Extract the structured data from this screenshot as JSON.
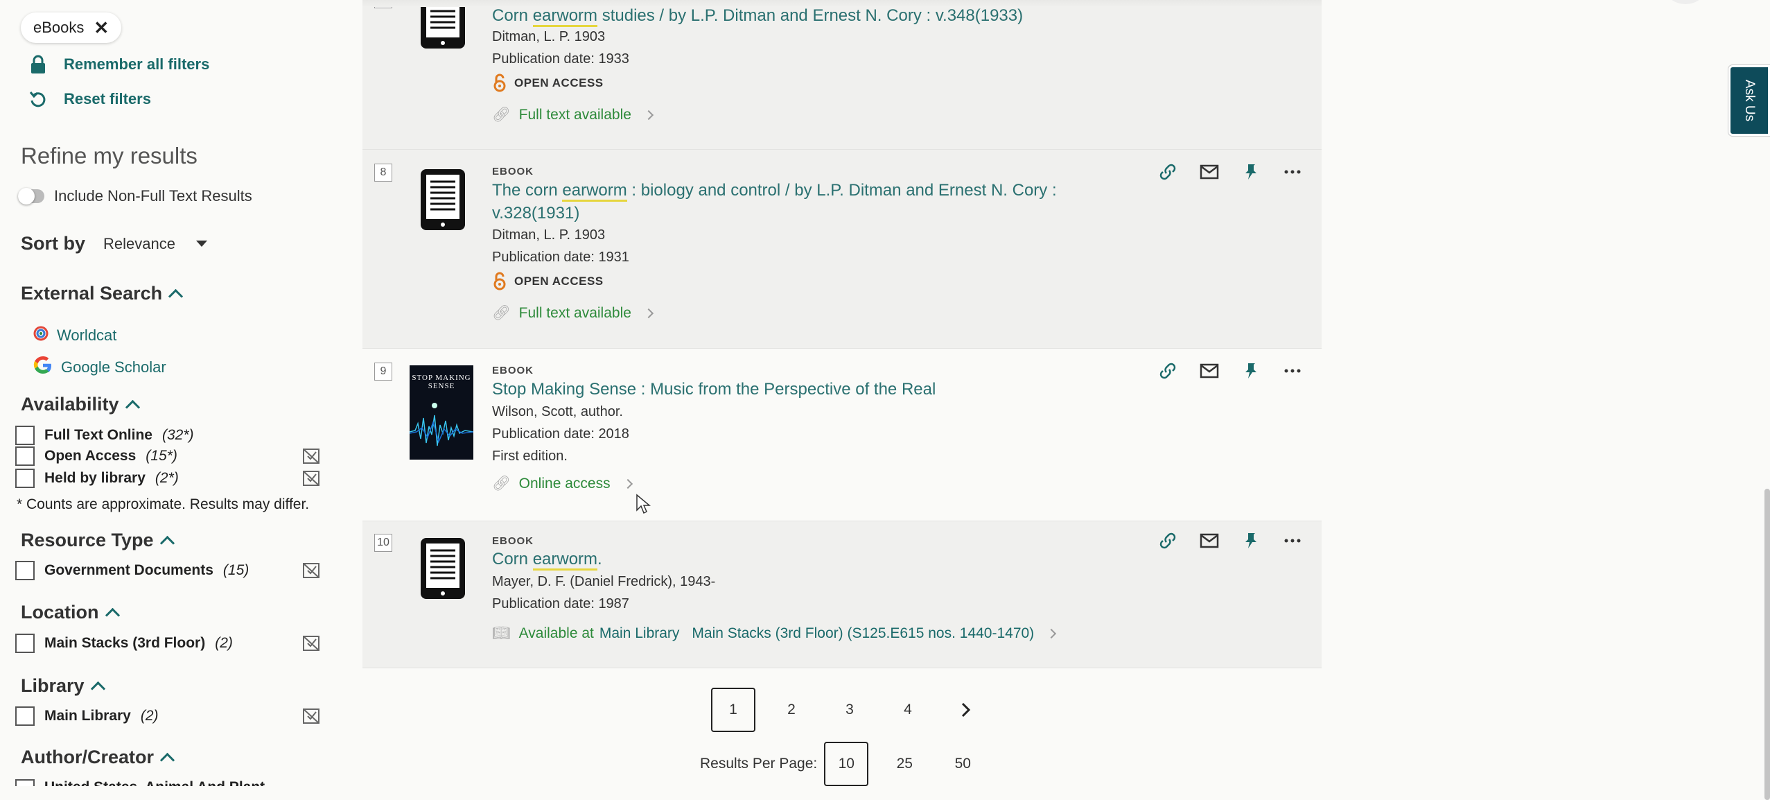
{
  "sidebar": {
    "chip_label": "eBooks",
    "remember_filters": "Remember all filters",
    "reset_filters": "Reset filters",
    "refine_title": "Refine my results",
    "include_non_full_text": "Include Non-Full Text Results",
    "sort_label": "Sort by",
    "sort_value": "Relevance",
    "external_search": {
      "title": "External Search",
      "items": [
        "Worldcat",
        "Google Scholar"
      ]
    },
    "availability": {
      "title": "Availability",
      "items": [
        {
          "name": "Full Text Online",
          "count": "(32*)"
        },
        {
          "name": "Open Access",
          "count": "(15*)"
        },
        {
          "name": "Held by library",
          "count": "(2*)"
        }
      ],
      "note": "* Counts are approximate. Results may differ."
    },
    "resource_type": {
      "title": "Resource Type",
      "items": [
        {
          "name": "Government Documents",
          "count": "(15)"
        }
      ]
    },
    "location": {
      "title": "Location",
      "items": [
        {
          "name": "Main Stacks (3rd Floor)",
          "count": "(2)"
        }
      ]
    },
    "library": {
      "title": "Library",
      "items": [
        {
          "name": "Main Library",
          "count": "(2)"
        }
      ]
    },
    "author": {
      "title": "Author/Creator",
      "partial_item": "United States. Animal And Plant"
    }
  },
  "results": [
    {
      "title_pre": "Corn ",
      "title_hl": "earworm",
      "title_post": " studies / by L.P. Ditman and Ernest N. Cory : v.348(1933)",
      "author": "Ditman, L. P. 1903",
      "pubdate": "Publication date: 1933",
      "open_access": "OPEN ACCESS",
      "link": "Full text available"
    },
    {
      "number": "8",
      "type": "EBOOK",
      "title_pre": "The corn ",
      "title_hl": "earworm",
      "title_post": " : biology and control / by L.P. Ditman and Ernest N. Cory : v.328(1931)",
      "author": "Ditman, L. P. 1903",
      "pubdate": "Publication date: 1931",
      "open_access": "OPEN ACCESS",
      "link": "Full text available"
    },
    {
      "number": "9",
      "type": "EBOOK",
      "title": "Stop Making Sense : Music from the Perspective of the Real",
      "author": "Wilson, Scott, author.",
      "pubdate": "Publication date: 2018",
      "edition": "First edition.",
      "link": "Online access",
      "cover_title": "STOP MAKING SENSE"
    },
    {
      "number": "10",
      "type": "EBOOK",
      "title_pre": "Corn ",
      "title_hl": "earworm",
      "title_post": ".",
      "author": "Mayer, D. F. (Daniel Fredrick), 1943-",
      "pubdate": "Publication date: 1987",
      "avail_prefix": "Available at",
      "avail_library": "Main Library",
      "avail_location": "Main Stacks (3rd Floor) (S125.E615 nos. 1440-1470)"
    }
  ],
  "pagination": {
    "pages": [
      "1",
      "2",
      "3",
      "4"
    ],
    "current": "1",
    "results_per_page_label": "Results Per Page:",
    "per_page_options": [
      "10",
      "25",
      "50"
    ]
  },
  "ask_us": "Ask Us",
  "colors": {
    "teal": "#1a6a6a",
    "green": "#2d8a3a",
    "open_access_orange": "#e07a1f",
    "ask_us_bg": "#0e4b5a"
  }
}
